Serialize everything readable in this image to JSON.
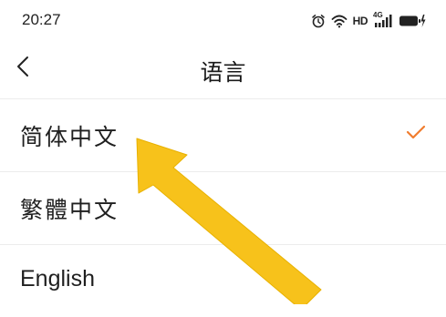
{
  "status_bar": {
    "time": "20:27",
    "hd_label": "HD",
    "network_label": "4G",
    "icons": [
      "alarm-icon",
      "wifi-icon",
      "hd-icon",
      "cellular-signal-icon",
      "battery-icon"
    ]
  },
  "header": {
    "title": "语言",
    "back_icon": "chevron-left-icon"
  },
  "languages": [
    {
      "label": "简体中文",
      "selected": true
    },
    {
      "label": "繁體中文",
      "selected": false
    },
    {
      "label": "English",
      "selected": false
    }
  ],
  "colors": {
    "accent_check": "#f07d2f",
    "arrow_fill": "#f7c21b"
  },
  "annotation": {
    "type": "arrow",
    "points_to": "简体中文"
  }
}
